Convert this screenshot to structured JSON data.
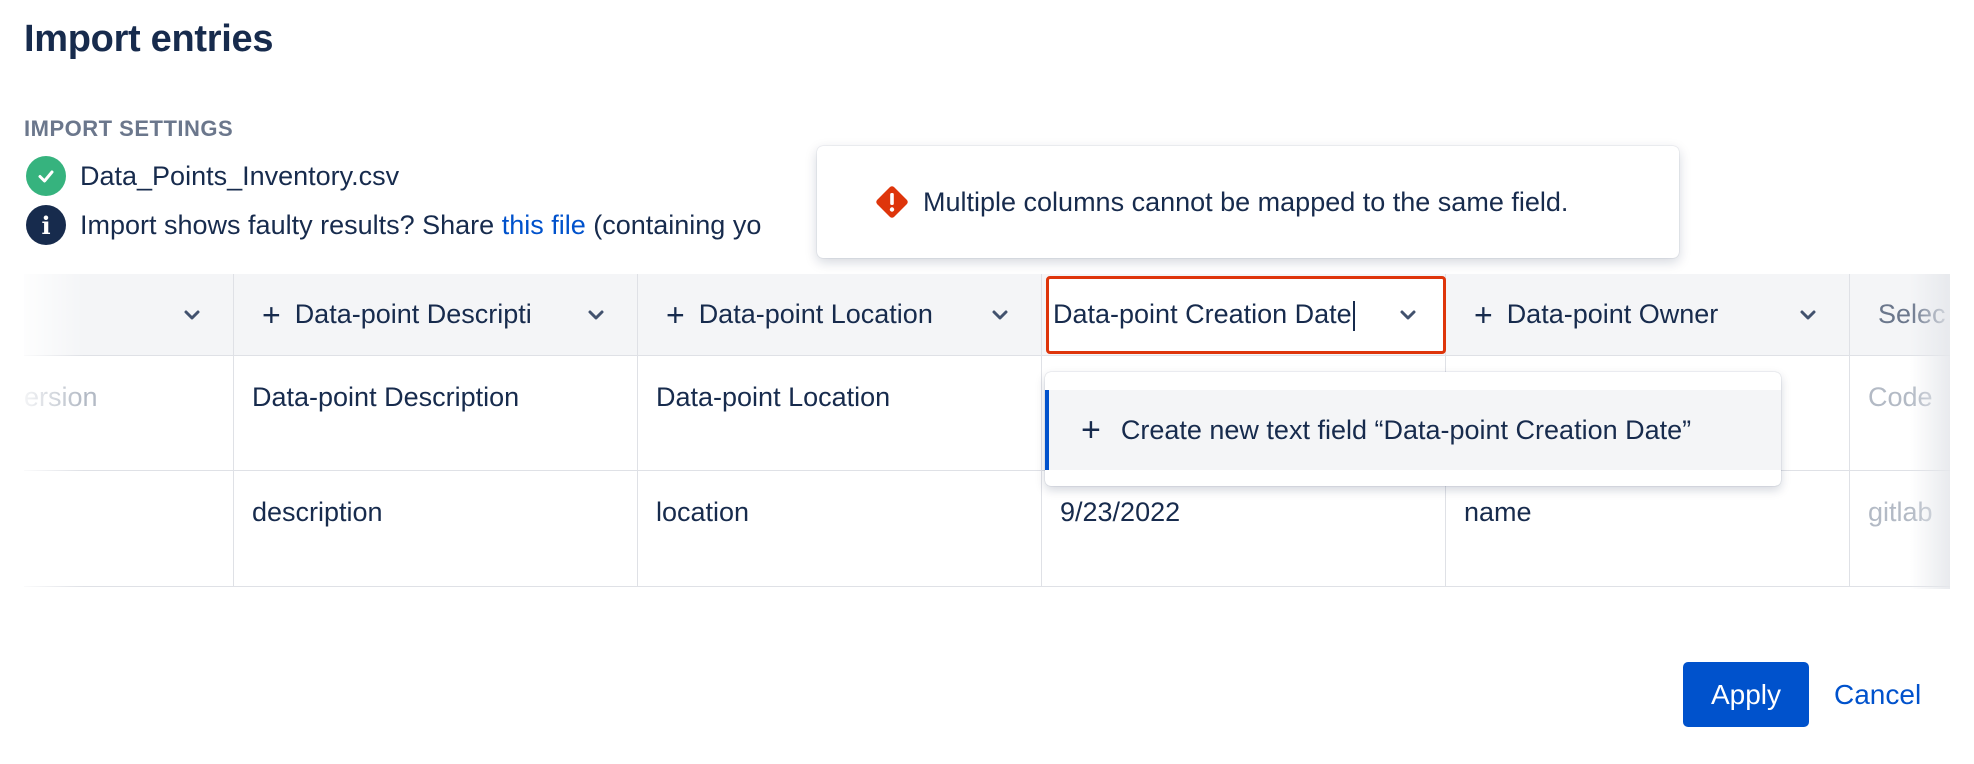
{
  "page": {
    "title": "Import entries",
    "section_label": "IMPORT SETTINGS",
    "file_name": "Data_Points_Inventory.csv",
    "help": {
      "prefix": "Import shows faulty results? Share ",
      "link": "this file",
      "suffix": " (containing yo"
    }
  },
  "error": {
    "message": "Multiple columns cannot be mapped to the same field.",
    "color": "#de350b"
  },
  "columns": [
    {
      "header": "",
      "has_plus": false,
      "row1": "ersion",
      "row2": ""
    },
    {
      "header": "Data-point Descripti",
      "has_plus": true,
      "row1": "Data-point Description",
      "row2": "description"
    },
    {
      "header": "Data-point Location",
      "has_plus": true,
      "row1": "Data-point Location",
      "row2": "location"
    },
    {
      "header": "Data-point Creation Date",
      "has_plus": false,
      "row1": "",
      "row2": "9/23/2022"
    },
    {
      "header": "Data-point Owner",
      "has_plus": true,
      "row1": "",
      "row2": "name"
    },
    {
      "header": "Selec",
      "has_plus": false,
      "row1": "Code",
      "row2": "gitlab"
    }
  ],
  "active_select": {
    "value": "Data-point Creation Date"
  },
  "dropdown": {
    "option": "Create new text field “Data-point Creation Date”"
  },
  "actions": {
    "apply": "Apply",
    "cancel": "Cancel"
  },
  "colors": {
    "primary": "#0052cc",
    "success": "#36b37e",
    "text": "#172b4d",
    "muted": "#6b778c"
  }
}
